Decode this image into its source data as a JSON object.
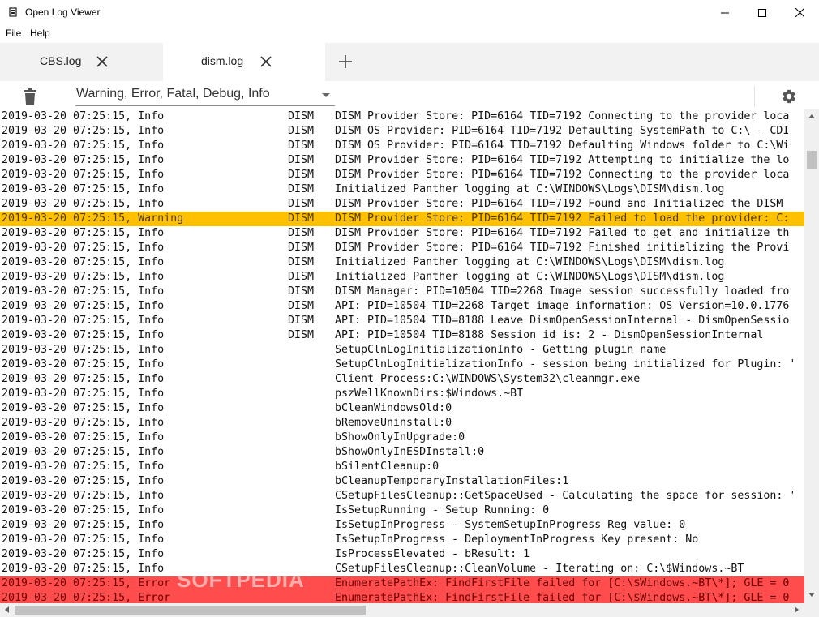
{
  "window": {
    "title": "Open Log Viewer",
    "minimize_icon": "minimize-icon",
    "maximize_icon": "maximize-icon",
    "close_icon": "close-icon"
  },
  "menu": {
    "items": [
      "File",
      "Help"
    ]
  },
  "tabs": [
    {
      "label": "CBS.log",
      "active": false
    },
    {
      "label": "dism.log",
      "active": true
    }
  ],
  "toolbar": {
    "filter_value": "Warning, Error, Fatal, Debug, Info",
    "clear_icon": "trash-icon",
    "settings_icon": "gear-icon",
    "add_tab_icon": "plus-icon"
  },
  "log": {
    "colors": {
      "warning": "#ffc000",
      "error": "#ff4d4d"
    },
    "rows": [
      {
        "date": "2019-03-20 07:25:15, Info",
        "source": "DISM",
        "message": "DISM Provider Store: PID=6164 TID=7192 Connecting to the provider loca",
        "level": "info"
      },
      {
        "date": "2019-03-20 07:25:15, Info",
        "source": "DISM",
        "message": "DISM OS Provider: PID=6164 TID=7192 Defaulting SystemPath to C:\\ - CDI",
        "level": "info"
      },
      {
        "date": "2019-03-20 07:25:15, Info",
        "source": "DISM",
        "message": "DISM OS Provider: PID=6164 TID=7192 Defaulting Windows folder to C:\\Wi",
        "level": "info"
      },
      {
        "date": "2019-03-20 07:25:15, Info",
        "source": "DISM",
        "message": "DISM Provider Store: PID=6164 TID=7192 Attempting to initialize the lo",
        "level": "info"
      },
      {
        "date": "2019-03-20 07:25:15, Info",
        "source": "DISM",
        "message": "DISM Provider Store: PID=6164 TID=7192 Connecting to the provider loca",
        "level": "info"
      },
      {
        "date": "2019-03-20 07:25:15, Info",
        "source": "DISM",
        "message": "Initialized Panther logging at C:\\WINDOWS\\Logs\\DISM\\dism.log",
        "level": "info"
      },
      {
        "date": "2019-03-20 07:25:15, Info",
        "source": "DISM",
        "message": "DISM Provider Store: PID=6164 TID=7192 Found and Initialized the DISM",
        "level": "info"
      },
      {
        "date": "2019-03-20 07:25:15, Warning",
        "source": "DISM",
        "message": "DISM Provider Store: PID=6164 TID=7192 Failed to load the provider: C:",
        "level": "warning"
      },
      {
        "date": "2019-03-20 07:25:15, Info",
        "source": "DISM",
        "message": "DISM Provider Store: PID=6164 TID=7192 Failed to get and initialize th",
        "level": "info"
      },
      {
        "date": "2019-03-20 07:25:15, Info",
        "source": "DISM",
        "message": "DISM Provider Store: PID=6164 TID=7192 Finished initializing the Provi",
        "level": "info"
      },
      {
        "date": "2019-03-20 07:25:15, Info",
        "source": "DISM",
        "message": "Initialized Panther logging at C:\\WINDOWS\\Logs\\DISM\\dism.log",
        "level": "info"
      },
      {
        "date": "2019-03-20 07:25:15, Info",
        "source": "DISM",
        "message": "Initialized Panther logging at C:\\WINDOWS\\Logs\\DISM\\dism.log",
        "level": "info"
      },
      {
        "date": "2019-03-20 07:25:15, Info",
        "source": "DISM",
        "message": "DISM Manager: PID=10504 TID=2268 Image session successfully loaded fro",
        "level": "info"
      },
      {
        "date": "2019-03-20 07:25:15, Info",
        "source": "DISM",
        "message": "API: PID=10504 TID=2268 Target image information: OS Version=10.0.1776",
        "level": "info"
      },
      {
        "date": "2019-03-20 07:25:15, Info",
        "source": "DISM",
        "message": "API: PID=10504 TID=8188 Leave DismOpenSessionInternal - DismOpenSessio",
        "level": "info"
      },
      {
        "date": "2019-03-20 07:25:15, Info",
        "source": "DISM",
        "message": "API: PID=10504 TID=8188 Session id is: 2 - DismOpenSessionInternal",
        "level": "info"
      },
      {
        "date": "2019-03-20 07:25:15, Info",
        "source": "",
        "message": "SetupClnLogInitializationInfo - Getting plugin name",
        "level": "info"
      },
      {
        "date": "2019-03-20 07:25:15, Info",
        "source": "",
        "message": "SetupClnLogInitializationInfo - session being initialized for Plugin: '",
        "level": "info"
      },
      {
        "date": "2019-03-20 07:25:15, Info",
        "source": "",
        "message": "Client Process:C:\\WINDOWS\\System32\\cleanmgr.exe",
        "level": "info"
      },
      {
        "date": "2019-03-20 07:25:15, Info",
        "source": "",
        "message": "pszWellKnownDirs:$Windows.~BT",
        "level": "info"
      },
      {
        "date": "2019-03-20 07:25:15, Info",
        "source": "",
        "message": "bCleanWindowsOld:0",
        "level": "info"
      },
      {
        "date": "2019-03-20 07:25:15, Info",
        "source": "",
        "message": "bRemoveUninstall:0",
        "level": "info"
      },
      {
        "date": "2019-03-20 07:25:15, Info",
        "source": "",
        "message": "bShowOnlyInUpgrade:0",
        "level": "info"
      },
      {
        "date": "2019-03-20 07:25:15, Info",
        "source": "",
        "message": "bShowOnlyInESDInstall:0",
        "level": "info"
      },
      {
        "date": "2019-03-20 07:25:15, Info",
        "source": "",
        "message": "bSilentCleanup:0",
        "level": "info"
      },
      {
        "date": "2019-03-20 07:25:15, Info",
        "source": "",
        "message": "bCleanupTemporaryInstallationFiles:1",
        "level": "info"
      },
      {
        "date": "2019-03-20 07:25:15, Info",
        "source": "",
        "message": "CSetupFilesCleanup::GetSpaceUsed - Calculating the space for session: '",
        "level": "info"
      },
      {
        "date": "2019-03-20 07:25:15, Info",
        "source": "",
        "message": "IsSetupRunning - Setup Running: 0",
        "level": "info"
      },
      {
        "date": "2019-03-20 07:25:15, Info",
        "source": "",
        "message": "IsSetupInProgress - SystemSetupInProgress Reg value: 0",
        "level": "info"
      },
      {
        "date": "2019-03-20 07:25:15, Info",
        "source": "",
        "message": "IsSetupInProgress - DeploymentInProgress Key present: No",
        "level": "info"
      },
      {
        "date": "2019-03-20 07:25:15, Info",
        "source": "",
        "message": "IsProcessElevated - bResult: 1",
        "level": "info"
      },
      {
        "date": "2019-03-20 07:25:15, Info",
        "source": "",
        "message": "CSetupFilesCleanup::CleanVolume - Iterating on: C:\\$Windows.~BT",
        "level": "info"
      },
      {
        "date": "2019-03-20 07:25:15, Error",
        "source": "",
        "message": "EnumeratePathEx: FindFirstFile failed for [C:\\$Windows.~BT\\*]; GLE = 0",
        "level": "error"
      },
      {
        "date": "2019-03-20 07:25:15, Error",
        "source": "",
        "message": "EnumeratePathEx: FindFirstFile failed for [C:\\$Windows.~BT\\*]; GLE = 0",
        "level": "error"
      }
    ]
  },
  "watermark": "SOFTPEDIA"
}
